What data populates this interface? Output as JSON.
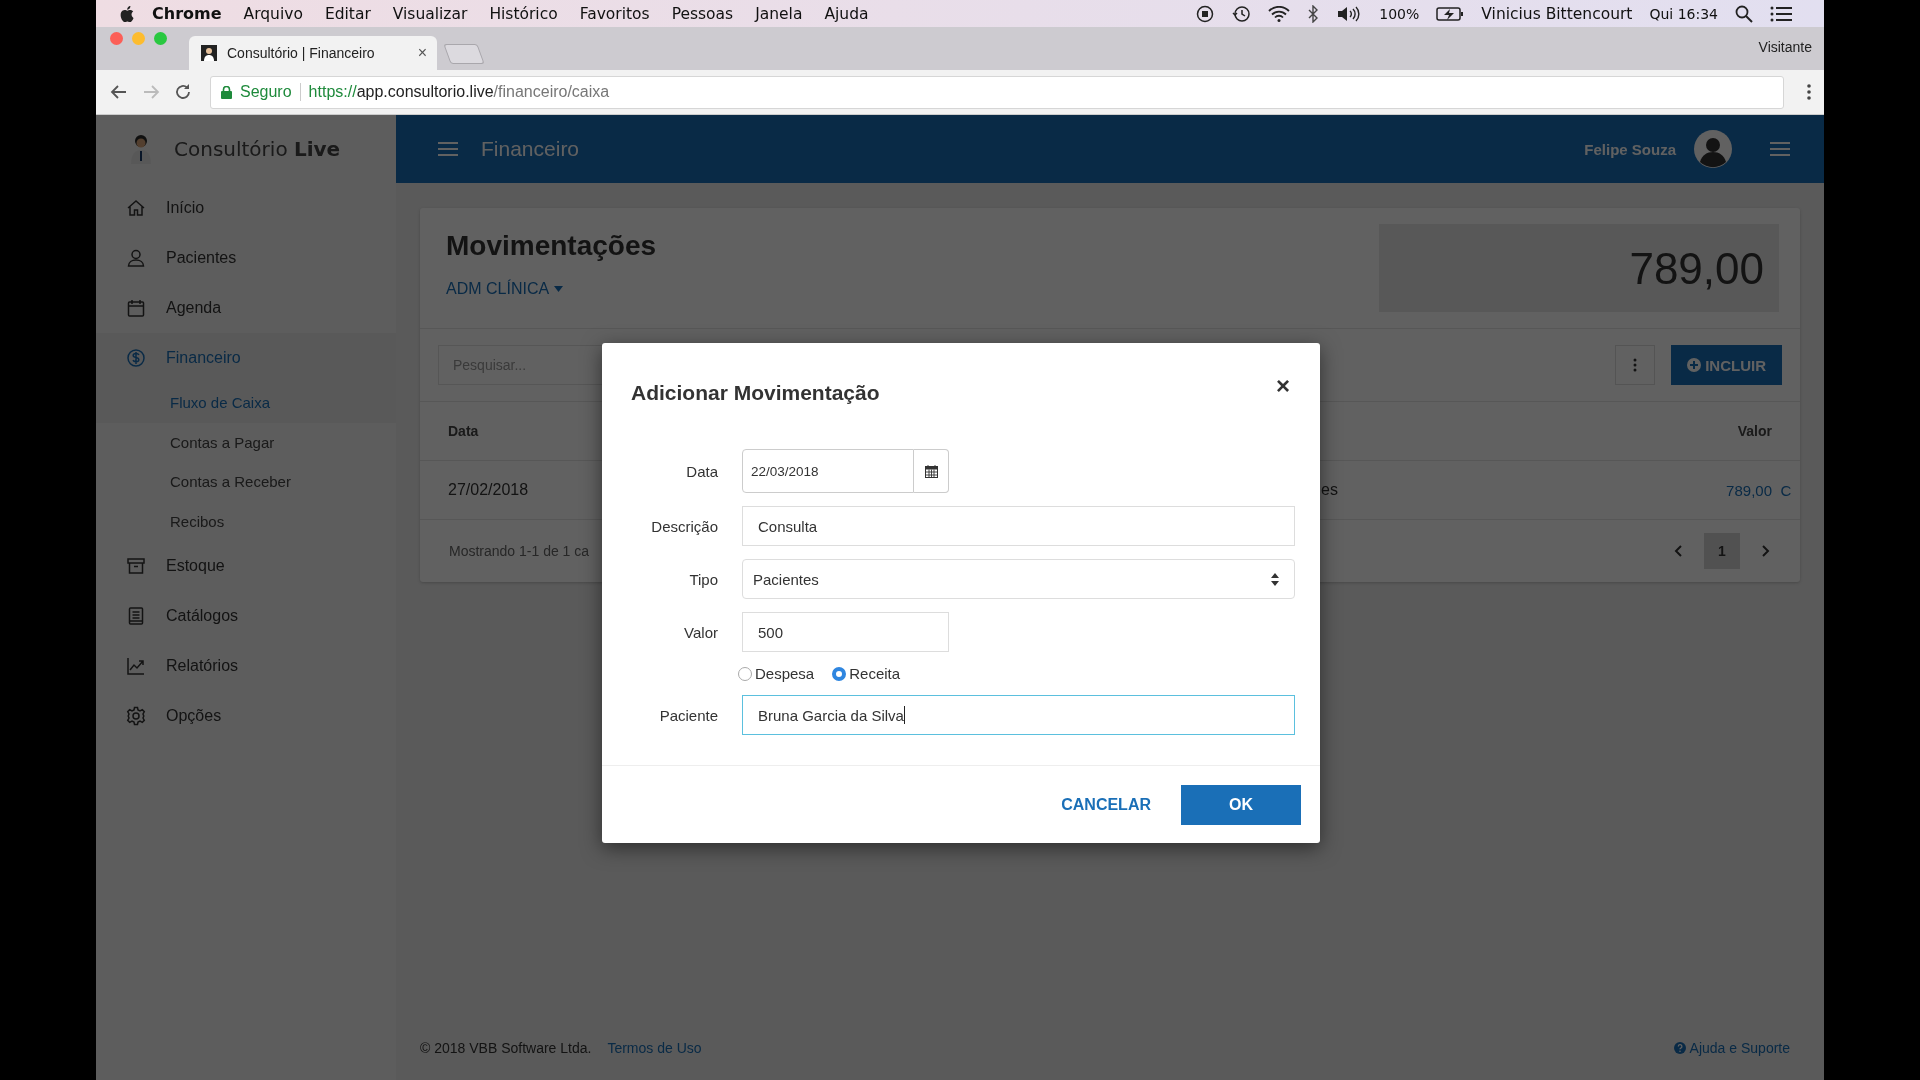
{
  "menubar": {
    "app": "Chrome",
    "menus": [
      "Arquivo",
      "Editar",
      "Visualizar",
      "Histórico",
      "Favoritos",
      "Pessoas",
      "Janela",
      "Ajuda"
    ],
    "battery": "100%",
    "user": "Vinicius Bittencourt",
    "clock": "Qui 16:34"
  },
  "browser": {
    "tab_title": "Consultório | Financeiro",
    "close": "×",
    "profile": "Visitante",
    "security": "Seguro",
    "url_scheme": "https://",
    "url_host": "app.consultorio.live",
    "url_path": "/financeiro/caixa"
  },
  "sidebar": {
    "brand": "Consultório",
    "brand_bold": "Live",
    "items": [
      {
        "label": "Início",
        "selected": false
      },
      {
        "label": "Pacientes",
        "selected": false
      },
      {
        "label": "Agenda",
        "selected": false
      },
      {
        "label": "Financeiro",
        "selected": true,
        "children": [
          {
            "label": "Fluxo de Caixa",
            "selected": true
          },
          {
            "label": "Contas a Pagar",
            "selected": false
          },
          {
            "label": "Contas a Receber",
            "selected": false
          },
          {
            "label": "Recibos",
            "selected": false
          }
        ]
      },
      {
        "label": "Estoque",
        "selected": false
      },
      {
        "label": "Catálogos",
        "selected": false
      },
      {
        "label": "Relatórios",
        "selected": false
      },
      {
        "label": "Opções",
        "selected": false
      }
    ]
  },
  "header": {
    "title": "Financeiro",
    "user": "Felipe Souza"
  },
  "page": {
    "title": "Movimentações",
    "account": "ADM CLÍNICA",
    "balance": "789,00",
    "search_placeholder": "Pesquisar...",
    "add_button": "INCLUIR",
    "table": {
      "columns": [
        "Data",
        "Valor"
      ],
      "rows": [
        {
          "date": "27/02/2018",
          "column_2": "es",
          "value": "789,00",
          "column_4": "C"
        }
      ]
    },
    "summary": "Mostrando 1-1 de 1 ca",
    "pages": [
      {
        "label": "1",
        "selected": true
      }
    ]
  },
  "footer": {
    "copyright": "© 2018 VBB Software Ltda.",
    "terms": "Termos de Uso",
    "help": "Ajuda e Suporte"
  },
  "modal": {
    "title": "Adicionar Movimentação",
    "close": "×",
    "fields": [
      {
        "kind": "date",
        "label": "Data",
        "value": "22/03/2018",
        "focused": false
      },
      {
        "kind": "text",
        "label": "Descrição",
        "value": "Consulta",
        "focused": false
      },
      {
        "kind": "select",
        "label": "Tipo",
        "value": "Pacientes",
        "focused": false
      },
      {
        "kind": "short",
        "label": "Valor",
        "value": "500",
        "focused": false
      },
      {
        "kind": "radios",
        "options": [
          {
            "label": "Despesa",
            "selected": false
          },
          {
            "label": "Receita",
            "selected": true
          }
        ]
      },
      {
        "kind": "text",
        "label": "Paciente",
        "value": "Bruna Garcia da Silva",
        "focused": true
      }
    ],
    "cancel": "CANCELAR",
    "ok": "OK"
  }
}
